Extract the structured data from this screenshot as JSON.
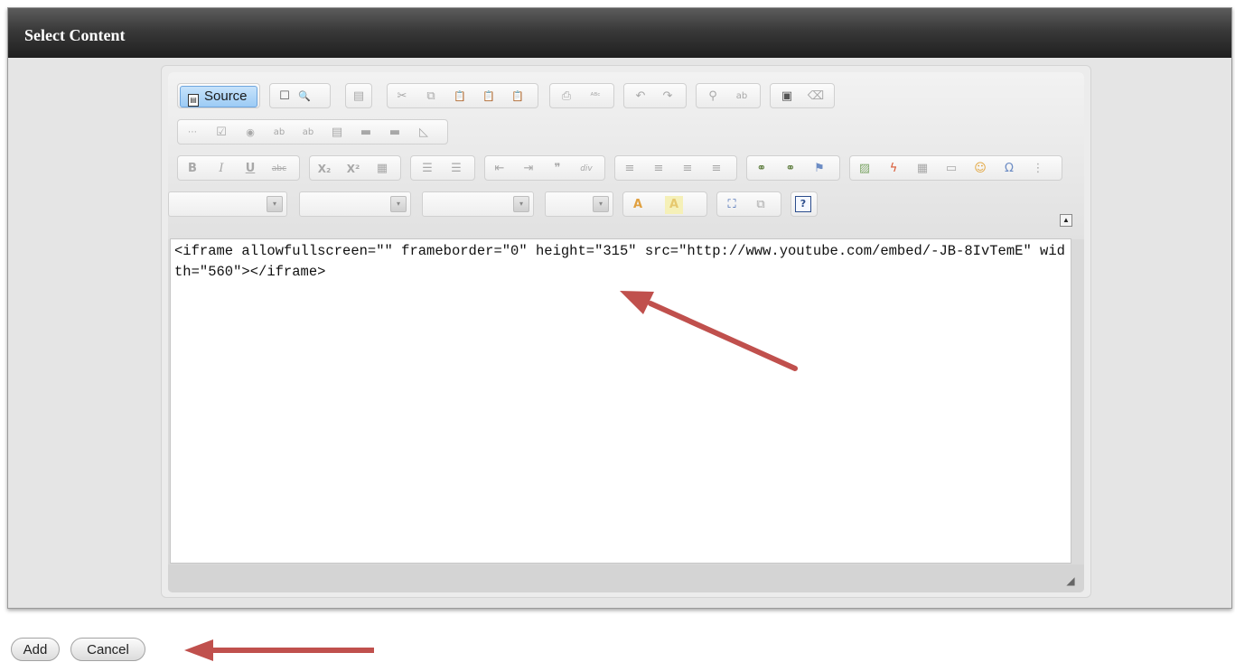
{
  "dialog": {
    "title": "Select Content"
  },
  "editor": {
    "source_label": "Source",
    "source_content": "<iframe allowfullscreen=\"\" frameborder=\"0\" height=\"315\" src=\"http://www.youtube.com/embed/-JB-8IvTemE\" width=\"560\"></iframe>",
    "toolbar_icons": {
      "row1": [
        "new-page-icon",
        "preview-icon",
        "templates-icon",
        "cut-icon",
        "copy-icon",
        "paste-icon",
        "paste-text-icon",
        "paste-word-icon",
        "print-icon",
        "spellcheck-icon",
        "undo-icon",
        "redo-icon",
        "find-icon",
        "replace-icon",
        "select-all-icon",
        "remove-format-icon"
      ],
      "row2": [
        "form-icon",
        "checkbox-icon",
        "radio-icon",
        "text-field-icon",
        "textarea-icon",
        "select-icon",
        "button-icon",
        "image-button-icon",
        "hidden-field-icon"
      ],
      "row3": [
        "bold-icon",
        "italic-icon",
        "underline-icon",
        "strike-icon",
        "subscript-icon",
        "superscript-icon",
        "special-icon",
        "numbered-list-icon",
        "bulleted-list-icon",
        "outdent-icon",
        "indent-icon",
        "blockquote-icon",
        "div-icon",
        "align-left-icon",
        "align-center-icon",
        "align-right-icon",
        "justify-icon",
        "link-icon",
        "unlink-icon",
        "anchor-icon",
        "image-icon",
        "flash-icon",
        "table-icon",
        "horizontal-rule-icon",
        "smiley-icon",
        "special-char-icon",
        "page-break-icon"
      ],
      "row4": [
        "text-color-icon",
        "background-color-icon",
        "maximize-icon",
        "show-blocks-icon",
        "about-icon"
      ]
    },
    "glyphs": {
      "new_page": "☐",
      "preview": "🔍",
      "templates": "▤",
      "cut": "✂",
      "copy": "⧉",
      "paste": "📋",
      "paste_text": "📋",
      "paste_word": "📋",
      "print": "⎙",
      "spellcheck": "ᴬᴮᶜ",
      "undo": "↶",
      "redo": "↷",
      "find": "⚲",
      "replace": "ab",
      "select_all": "▣",
      "remove_format": "⌫",
      "form": "⋯",
      "checkbox": "☑",
      "radio": "◉",
      "text_field": "ab",
      "textarea": "ab",
      "select": "▤",
      "button": "▬",
      "image_button": "▬",
      "hidden_field": "◺",
      "bold": "B",
      "italic": "I",
      "underline": "U",
      "strike": "abc",
      "subscript": "X₂",
      "superscript": "X²",
      "special": "▦",
      "numbered_list": "☰",
      "bulleted_list": "☰",
      "outdent": "⇤",
      "indent": "⇥",
      "blockquote": "❞",
      "div": "div",
      "align_left": "≡",
      "align_center": "≡",
      "align_right": "≡",
      "justify": "≡",
      "link": "⚭",
      "unlink": "⚭",
      "anchor": "⚑",
      "image": "▨",
      "flash": "ϟ",
      "table": "▦",
      "horizontal_rule": "▭",
      "smiley": "☺",
      "special_char": "Ω",
      "page_break": "⋮",
      "text_color": "A",
      "background_color": "A",
      "maximize": "⛶",
      "show_blocks": "⧉",
      "about": "?",
      "combo_arrow": "▾",
      "collapse": "▲",
      "resize": "◢"
    }
  },
  "buttons": {
    "add": "Add",
    "cancel": "Cancel"
  },
  "colors": {
    "annotation_arrow": "#c0504d",
    "source_button": "#9ccbf5"
  }
}
